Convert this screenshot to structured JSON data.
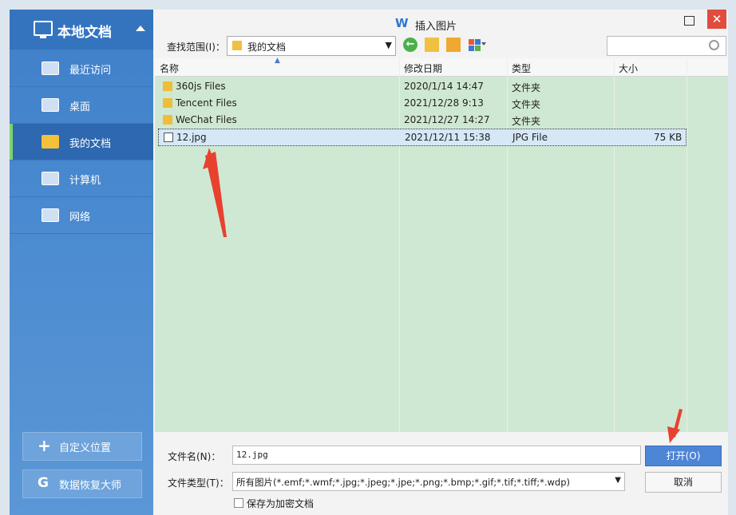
{
  "sidebar": {
    "header": "本地文档",
    "items": [
      {
        "label": "最近访问",
        "icon": "recent-icon"
      },
      {
        "label": "桌面",
        "icon": "desktop-icon"
      },
      {
        "label": "我的文档",
        "icon": "folder-icon",
        "active": true
      },
      {
        "label": "计算机",
        "icon": "computer-icon"
      },
      {
        "label": "网络",
        "icon": "network-icon"
      }
    ],
    "custom_location": "自定义位置",
    "data_recovery": "数据恢复大师"
  },
  "dialog": {
    "title_glyph": "W",
    "title": "插入图片",
    "close_glyph": "✕",
    "look_in_label": "查找范围(I)：",
    "look_in_value": "我的文档",
    "back_glyph": "←"
  },
  "list": {
    "columns": [
      "名称",
      "修改日期",
      "类型",
      "大小"
    ],
    "rows": [
      {
        "name": "360js Files",
        "date": "2020/1/14 14:47",
        "type": "文件夹",
        "size": "",
        "kind": "folder"
      },
      {
        "name": "Tencent Files",
        "date": "2021/12/28 9:13",
        "type": "文件夹",
        "size": "",
        "kind": "folder"
      },
      {
        "name": "WeChat Files",
        "date": "2021/12/27 14:27",
        "type": "文件夹",
        "size": "",
        "kind": "folder"
      },
      {
        "name": "12.jpg",
        "date": "2021/12/11 15:38",
        "type": "JPG File",
        "size": "75 KB",
        "kind": "image",
        "selected": true
      }
    ]
  },
  "bottom": {
    "file_name_label": "文件名(N)：",
    "file_name_value": "12.jpg",
    "file_type_label": "文件类型(T)：",
    "file_type_value": "所有图片(*.emf;*.wmf;*.jpg;*.jpeg;*.jpe;*.png;*.bmp;*.gif;*.tif;*.tiff;*.wdp)",
    "open_button": "打开(O)",
    "cancel_button": "取消",
    "save_encrypted": "保存为加密文档"
  },
  "colors": {
    "sidebar": "#4a8ad0",
    "list_bg": "#cfe8d3",
    "close": "#e04c3d",
    "annotation": "#e8412e"
  }
}
